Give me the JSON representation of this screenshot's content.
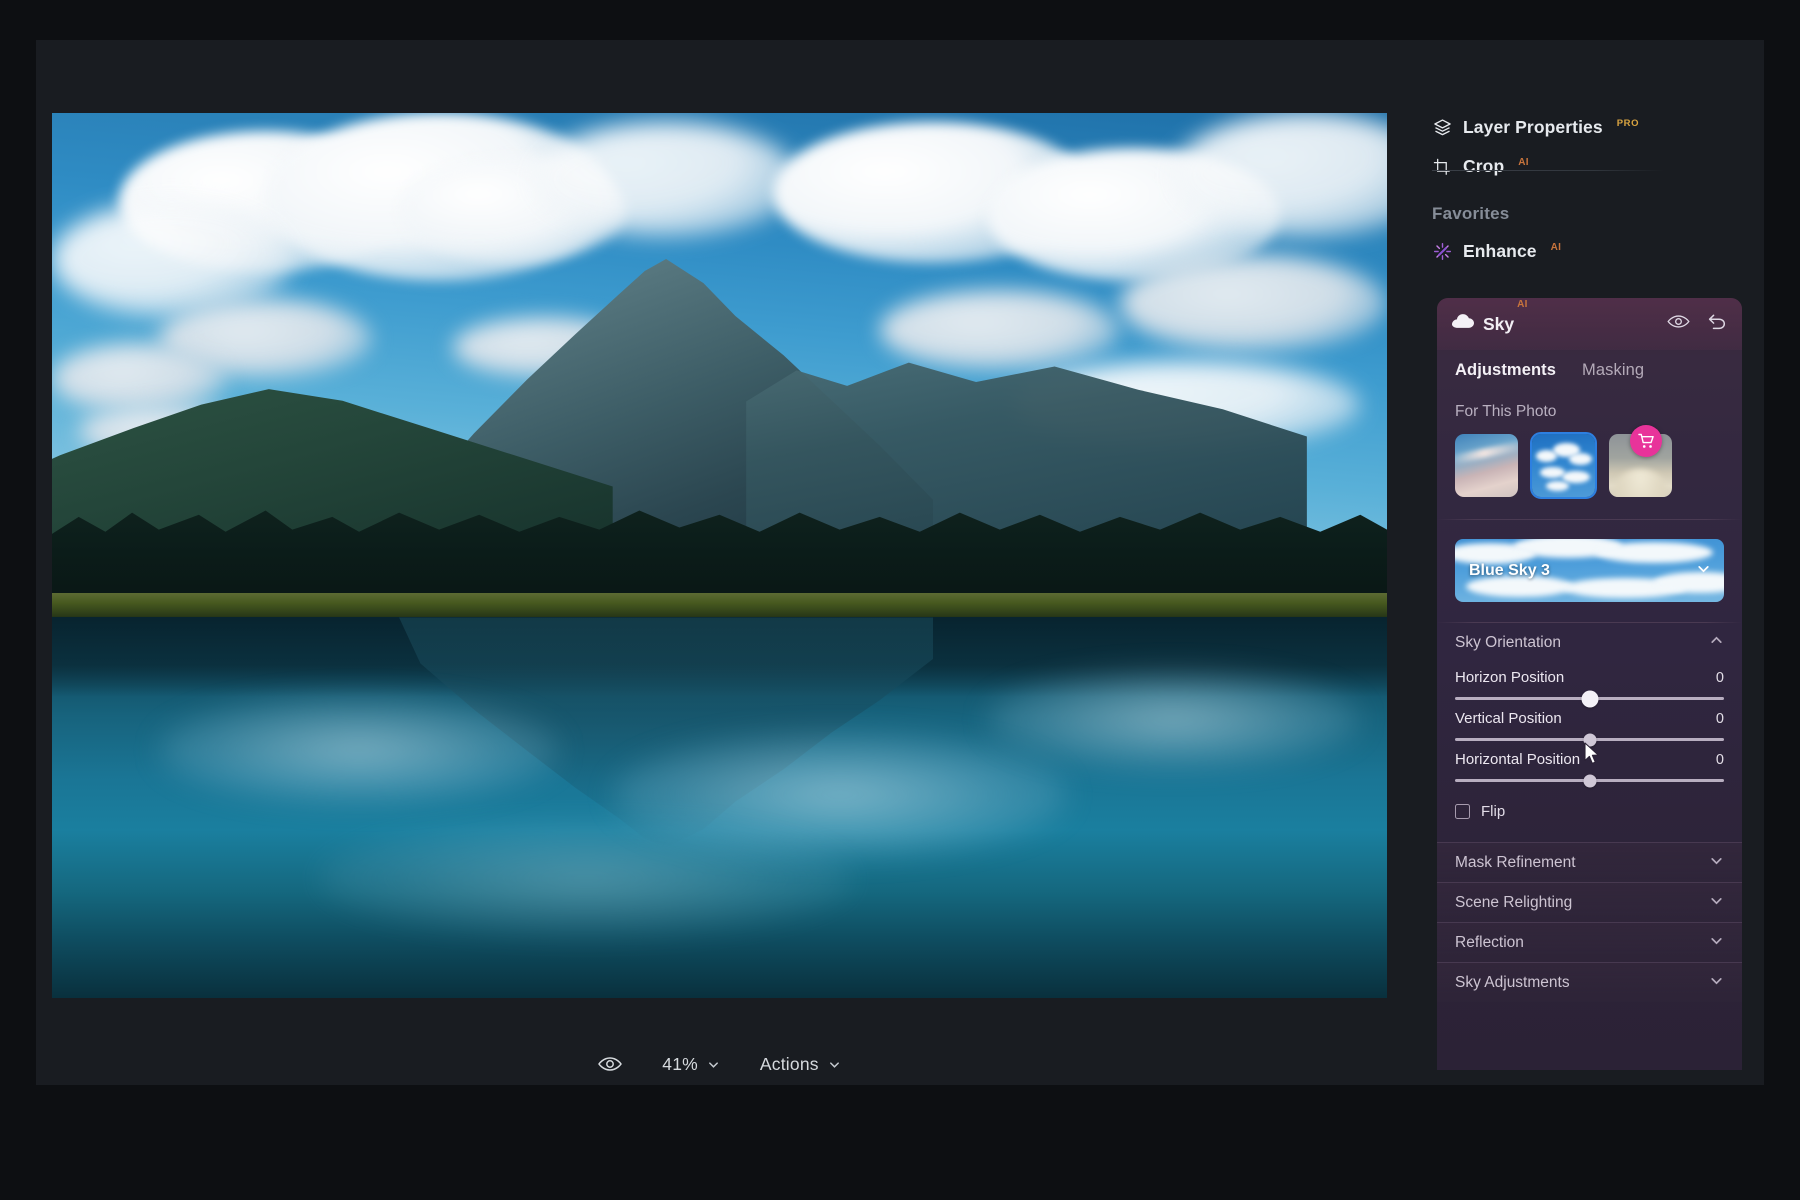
{
  "app": {
    "zoom_level": "41%",
    "accent_pink": "#e8339a",
    "accent_blue": "#2d7fe0",
    "panel_bg": "#312640"
  },
  "sidebar": {
    "items": [
      {
        "label": "Layer Properties",
        "icon": "layers-icon",
        "badge": "PRO"
      },
      {
        "label": "Crop",
        "icon": "crop-icon",
        "badge": "AI"
      }
    ],
    "section_label": "Favorites",
    "favorites": [
      {
        "label": "Enhance",
        "icon": "sparkle-icon",
        "badge": "AI"
      }
    ]
  },
  "sky_panel": {
    "title": "Sky",
    "badge": "AI",
    "icon": "cloud-icon",
    "visibility_icon": "eye-icon",
    "reset_icon": "undo-icon",
    "tabs": [
      {
        "label": "Adjustments",
        "active": true
      },
      {
        "label": "Masking",
        "active": false
      }
    ],
    "for_this_photo_label": "For This Photo",
    "thumbnails": [
      {
        "name": "wispy-sunset-sky-thumbnail",
        "selected": false,
        "has_cart": false
      },
      {
        "name": "blue-cloudy-sky-thumbnail",
        "selected": true,
        "has_cart": false
      },
      {
        "name": "foggy-sky-thumbnail",
        "selected": false,
        "has_cart": true
      }
    ],
    "cart_icon": "shopping-cart-icon",
    "preset": {
      "name": "Blue Sky 3",
      "chevron": "chevron-down-icon"
    },
    "orientation": {
      "title": "Sky Orientation",
      "expanded": true,
      "chevron": "chevron-up-icon",
      "sliders": [
        {
          "label": "Horizon Position",
          "value": "0",
          "percent": 50,
          "active": true
        },
        {
          "label": "Vertical Position",
          "value": "0",
          "percent": 50,
          "active": false
        },
        {
          "label": "Horizontal Position",
          "value": "0",
          "percent": 50,
          "active": false
        }
      ],
      "flip": {
        "label": "Flip",
        "checked": false
      }
    },
    "collapsed_sections": [
      {
        "label": "Mask Refinement",
        "chevron": "chevron-down-icon"
      },
      {
        "label": "Scene Relighting",
        "chevron": "chevron-down-icon"
      },
      {
        "label": "Reflection",
        "chevron": "chevron-down-icon"
      },
      {
        "label": "Sky Adjustments",
        "chevron": "chevron-down-icon"
      }
    ]
  },
  "bottom_bar": {
    "preview_icon": "eye-icon",
    "zoom_label": "41%",
    "zoom_chevron": "chevron-down-icon",
    "actions_label": "Actions",
    "actions_chevron": "chevron-down-icon"
  }
}
